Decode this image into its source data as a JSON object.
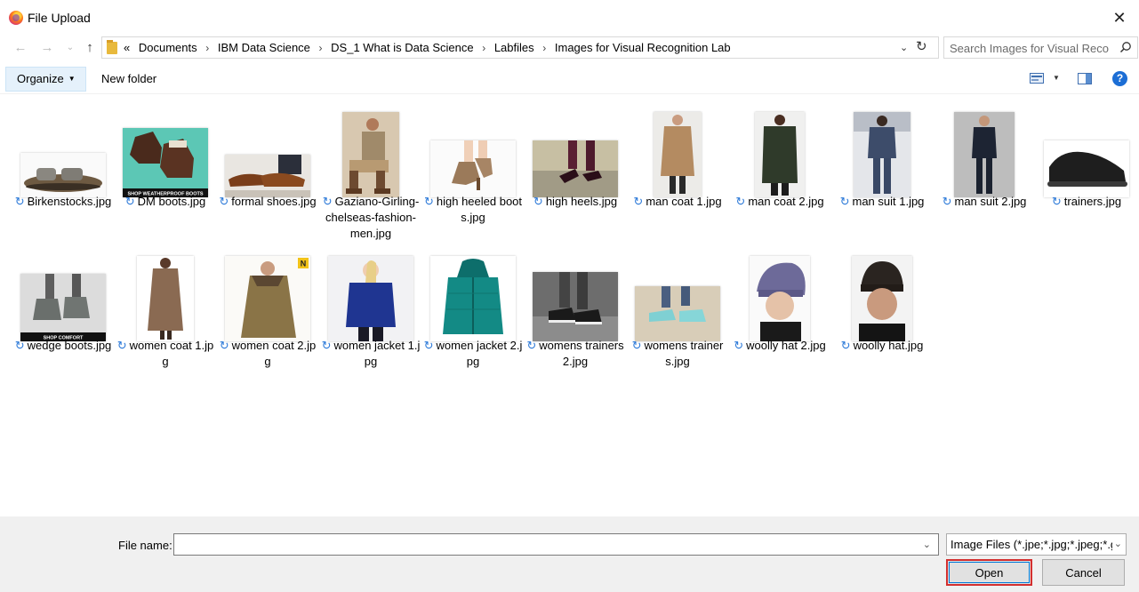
{
  "window": {
    "title": "File Upload"
  },
  "nav": {
    "breadcrumbs": [
      "Documents",
      "IBM Data Science",
      "DS_1 What is Data Science",
      "Labfiles",
      "Images for Visual Recognition Lab"
    ],
    "overflow": "«",
    "search_placeholder": "Search Images for Visual Reco..."
  },
  "toolbar": {
    "organize_label": "Organize",
    "new_folder_label": "New folder"
  },
  "files": [
    {
      "name": "Birkenstocks.jpg",
      "icon": "sandals"
    },
    {
      "name": "DM boots.jpg",
      "icon": "boots",
      "caption": "SHOP WEATHERPROOF BOOTS"
    },
    {
      "name": "formal shoes.jpg",
      "icon": "shoes"
    },
    {
      "name": "Gaziano-Girling-chelseas-fashion-men.jpg",
      "icon": "person-seated"
    },
    {
      "name": "high heeled boots.jpg",
      "icon": "heeled-boots"
    },
    {
      "name": "high heels.jpg",
      "icon": "heels"
    },
    {
      "name": "man coat 1.jpg",
      "icon": "coat"
    },
    {
      "name": "man coat 2.jpg",
      "icon": "coat"
    },
    {
      "name": "man suit 1.jpg",
      "icon": "suit"
    },
    {
      "name": "man suit 2.jpg",
      "icon": "suit"
    },
    {
      "name": "trainers.jpg",
      "icon": "trainers"
    },
    {
      "name": "wedge boots.jpg",
      "icon": "wedges",
      "caption": "SHOP COMFORT"
    },
    {
      "name": "women coat 1.jpg",
      "icon": "coat"
    },
    {
      "name": "women coat 2.jpg",
      "icon": "coat",
      "badge": "N"
    },
    {
      "name": "women jacket 1.jpg",
      "icon": "jacket"
    },
    {
      "name": "women jacket 2.jpg",
      "icon": "jacket"
    },
    {
      "name": "womens trainers 2.jpg",
      "icon": "trainers"
    },
    {
      "name": "womens trainers.jpg",
      "icon": "trainers"
    },
    {
      "name": "woolly hat 2.jpg",
      "icon": "hat"
    },
    {
      "name": "woolly hat.jpg",
      "icon": "hat"
    }
  ],
  "bottom": {
    "file_name_label": "File name:",
    "file_name_value": "",
    "filter_value": "Image Files (*.jpe;*.jpg;*.jpeg;*.g",
    "open_label": "Open",
    "cancel_label": "Cancel"
  }
}
